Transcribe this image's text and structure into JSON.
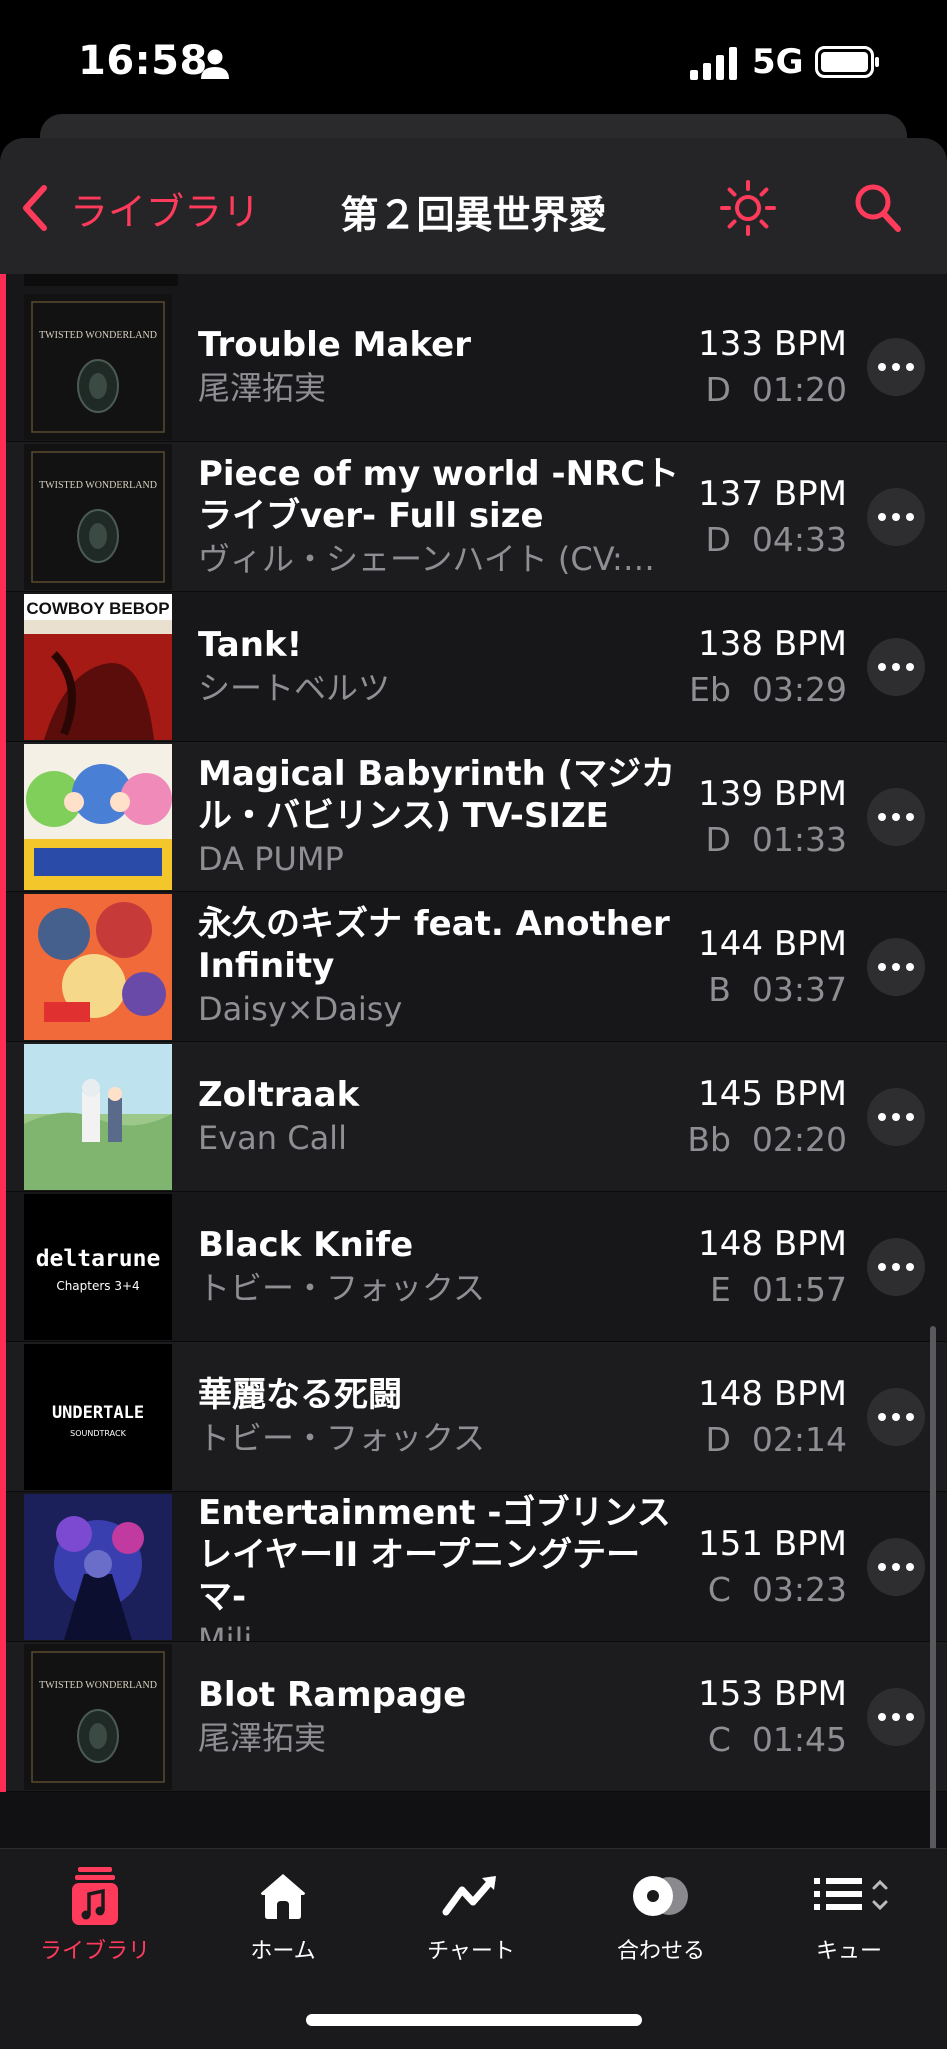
{
  "status_bar": {
    "time": "16:58",
    "network": "5G"
  },
  "header": {
    "back_label": "ライブラリ",
    "title": "第２回異世界愛"
  },
  "tracks": [
    {
      "title": "Trouble Maker",
      "artist": "尾澤拓実",
      "bpm": "133 BPM",
      "key": "D",
      "duration": "01:20",
      "art": "twisted-wonderland"
    },
    {
      "title": "Piece of my world -NRCトライブver- Full size",
      "artist": "ヴィル・シェーンハイト (CV:…",
      "bpm": "137 BPM",
      "key": "D",
      "duration": "04:33",
      "art": "twisted-wonderland"
    },
    {
      "title": "Tank!",
      "artist": "シートベルツ",
      "bpm": "138 BPM",
      "key": "Eb",
      "duration": "03:29",
      "art": "cowboy-bebop"
    },
    {
      "title": "Magical Babyrinth (マジカル・バビリンス) TV-SIZE",
      "artist": "DA PUMP",
      "bpm": "139 BPM",
      "key": "D",
      "duration": "01:33",
      "art": "anime-colorful"
    },
    {
      "title": "永久のキズナ feat. Another Infinity",
      "artist": "Daisy×Daisy",
      "bpm": "144 BPM",
      "key": "B",
      "duration": "03:37",
      "art": "fairy-tail"
    },
    {
      "title": "Zoltraak",
      "artist": "Evan Call",
      "bpm": "145 BPM",
      "key": "Bb",
      "duration": "02:20",
      "art": "frieren"
    },
    {
      "title": "Black Knife",
      "artist": "トビー・フォックス",
      "bpm": "148 BPM",
      "key": "E",
      "duration": "01:57",
      "art": "deltarune"
    },
    {
      "title": "華麗なる死闘",
      "artist": "トビー・フォックス",
      "bpm": "148 BPM",
      "key": "D",
      "duration": "02:14",
      "art": "undertale"
    },
    {
      "title": "Entertainment -ゴブリンスレイヤーII オープニングテーマ-",
      "artist": "Mili",
      "bpm": "151 BPM",
      "key": "C",
      "duration": "03:23",
      "art": "goblin-slayer"
    },
    {
      "title": "Blot Rampage",
      "artist": "尾澤拓実",
      "bpm": "153 BPM",
      "key": "C",
      "duration": "01:45",
      "art": "twisted-wonderland"
    }
  ],
  "album_art_text": {
    "twisted_wonderland": "TWISTED WONDERLAND",
    "cowboy_bebop": "COWBOY BEBOP",
    "deltarune": "deltarune",
    "deltarune_sub": "Chapters 3+4",
    "undertale": "UNDERTALE",
    "undertale_sub": "SOUNDTRACK"
  },
  "tab_bar": {
    "items": [
      {
        "label": "ライブラリ",
        "icon": "music-library-icon",
        "active": true
      },
      {
        "label": "ホーム",
        "icon": "home-icon",
        "active": false
      },
      {
        "label": "チャート",
        "icon": "chart-icon",
        "active": false
      },
      {
        "label": "合わせる",
        "icon": "match-disc-icon",
        "active": false
      },
      {
        "label": "キュー",
        "icon": "queue-icon",
        "active": false
      }
    ]
  },
  "colors": {
    "accent": "#ff3b5c",
    "background": "#111113",
    "secondary_text": "#8e8e93"
  }
}
